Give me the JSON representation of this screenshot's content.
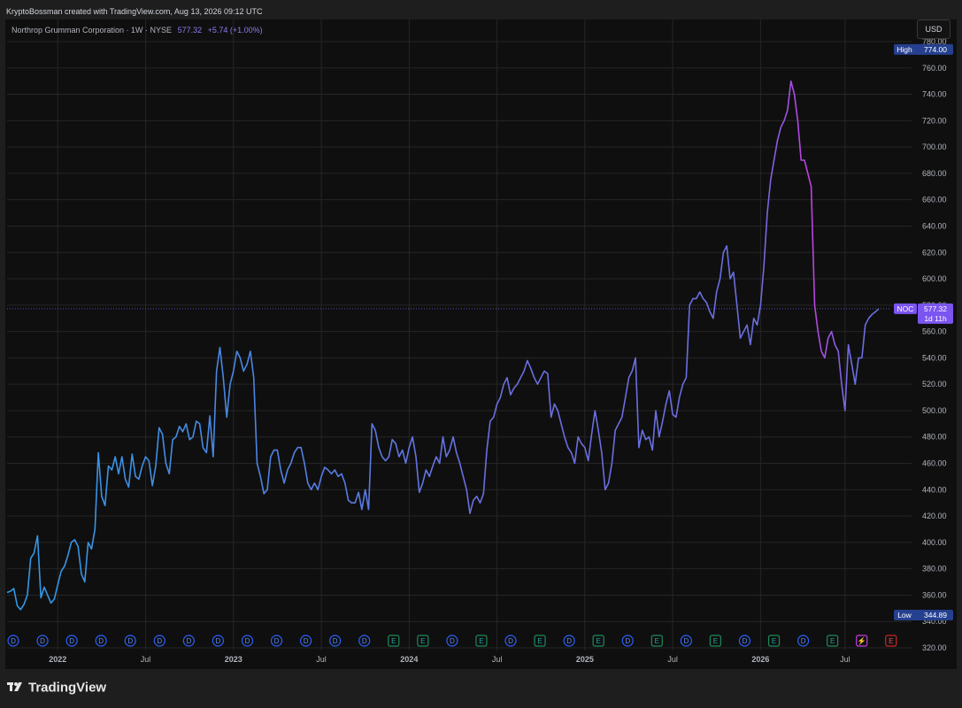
{
  "header": {
    "credit": "KryptoBossman created with TradingView.com, Aug 13, 2026 09:12 UTC"
  },
  "legend": {
    "symbol": "Northrop Grumman Corporation · 1W · NYSE",
    "price": "577.32",
    "change": "+5.74 (+1.00%)"
  },
  "currency_button": "USD",
  "footer": {
    "brand": "TradingView"
  },
  "colors": {
    "background": "#0f0f0f",
    "line_start": "#2e9be6",
    "line_mid": "#6a6ee0",
    "line_end": "#c23fe0",
    "label_blue": "#25408f",
    "label_purple": "#7b55f0"
  },
  "chart_data": {
    "type": "line",
    "title": "Northrop Grumman Corporation · 1W · NYSE",
    "series": [
      {
        "x_week_index": [
          0,
          1,
          2,
          3,
          4,
          5,
          6,
          7,
          8,
          9,
          10,
          11,
          12,
          13,
          14,
          15,
          16,
          17,
          18,
          19,
          20,
          21,
          22,
          23,
          24,
          25,
          26,
          27,
          28,
          29,
          30,
          31,
          32,
          33,
          34,
          35,
          36,
          37,
          38,
          39,
          40,
          41,
          42,
          43,
          44,
          45,
          46,
          47,
          48,
          49,
          50,
          51,
          52,
          53,
          54,
          55,
          56,
          57,
          58,
          59,
          60,
          61,
          62,
          63,
          64,
          65,
          66,
          67,
          68,
          69,
          70,
          71,
          72,
          73,
          74,
          75,
          76,
          77,
          78,
          79,
          80,
          81,
          82,
          83,
          84,
          85,
          86,
          87,
          88,
          89,
          90,
          91,
          92,
          93,
          94,
          95,
          96,
          97,
          98,
          99,
          100,
          101,
          102,
          103,
          104,
          105,
          106,
          107,
          108,
          109,
          110,
          111,
          112,
          113,
          114,
          115,
          116,
          117,
          118,
          119,
          120,
          121,
          122,
          123,
          124,
          125,
          126,
          127,
          128,
          129,
          130,
          131,
          132,
          133,
          134,
          135,
          136,
          137,
          138,
          139,
          140,
          141,
          142,
          143,
          144,
          145,
          146,
          147,
          148,
          149,
          150,
          151,
          152,
          153,
          154,
          155,
          156,
          157,
          158,
          159,
          160,
          161,
          162,
          163,
          164,
          165,
          166,
          167,
          168,
          169,
          170,
          171,
          172,
          173,
          174,
          175,
          176,
          177,
          178,
          179,
          180,
          181,
          182,
          183,
          184,
          185,
          186,
          187,
          188,
          189,
          190,
          191,
          192,
          193,
          194,
          195,
          196,
          197,
          198,
          199,
          200,
          201,
          202,
          203,
          204,
          205,
          206,
          207,
          208,
          209,
          210,
          211,
          212,
          213,
          214,
          215,
          216,
          217,
          218,
          219,
          220,
          221,
          222,
          223,
          224,
          225,
          226,
          227,
          228,
          229,
          230,
          231,
          232,
          233,
          234,
          235,
          236,
          237,
          238,
          239,
          240,
          241,
          242,
          243,
          244,
          245,
          246,
          247,
          248,
          249,
          250,
          251,
          252,
          253,
          254,
          255,
          256,
          257,
          258,
          259,
          260,
          261,
          262,
          263,
          264,
          265,
          266,
          267,
          268,
          269,
          270,
          271,
          272
        ],
        "values": [
          362,
          363,
          365,
          352,
          349,
          353,
          360,
          388,
          392,
          405,
          358,
          366,
          360,
          354,
          357,
          368,
          378,
          382,
          390,
          400,
          402,
          397,
          376,
          370,
          400,
          395,
          410,
          468,
          435,
          428,
          458,
          455,
          465,
          452,
          465,
          448,
          442,
          467,
          450,
          448,
          458,
          465,
          462,
          443,
          458,
          487,
          482,
          460,
          452,
          478,
          480,
          488,
          484,
          490,
          478,
          480,
          492,
          490,
          472,
          468,
          496,
          465,
          530,
          548,
          525,
          495,
          520,
          530,
          545,
          540,
          530,
          535,
          545,
          525,
          460,
          450,
          437,
          440,
          465,
          470,
          470,
          455,
          445,
          455,
          460,
          468,
          472,
          472,
          460,
          445,
          440,
          445,
          440,
          450,
          457,
          455,
          452,
          455,
          450,
          452,
          445,
          432,
          430,
          430,
          438,
          425,
          440,
          425,
          490,
          485,
          472,
          465,
          462,
          465,
          478,
          475,
          465,
          470,
          460,
          472,
          480,
          465,
          438,
          445,
          455,
          450,
          458,
          465,
          460,
          480,
          465,
          470,
          480,
          468,
          460,
          450,
          440,
          422,
          432,
          435,
          430,
          437,
          470,
          492,
          495,
          505,
          510,
          520,
          525,
          512,
          517,
          520,
          525,
          530,
          538,
          532,
          525,
          520,
          525,
          530,
          528,
          495,
          505,
          500,
          490,
          480,
          472,
          468,
          460,
          480,
          475,
          472,
          462,
          482,
          500,
          485,
          468,
          440,
          445,
          460,
          485,
          490,
          495,
          510,
          525,
          530,
          540,
          472,
          485,
          478,
          480,
          470,
          500,
          480,
          492,
          505,
          515,
          497,
          495,
          510,
          520,
          525,
          580,
          585,
          585,
          590,
          585,
          582,
          575,
          570,
          590,
          600,
          620,
          625,
          600,
          605,
          580,
          555,
          560,
          565,
          550,
          570,
          565,
          580,
          610,
          650,
          675,
          690,
          705,
          715,
          720,
          728,
          750,
          740,
          720,
          690,
          690,
          680,
          670,
          580,
          560,
          545,
          540,
          555,
          560,
          550,
          545,
          520,
          500,
          550,
          535,
          520,
          540,
          540,
          565,
          570,
          573,
          575,
          577.32
        ],
        "color_gradient": [
          "#2e9be6",
          "#6a6ee0",
          "#c23fe0"
        ]
      }
    ],
    "x_tick_labels": [
      "2022",
      "Jul",
      "2023",
      "Jul",
      "2024",
      "Jul",
      "2025",
      "Jul",
      "2026",
      "Jul"
    ],
    "y_tick_labels": [
      "320.00",
      "340.00",
      "360.00",
      "380.00",
      "400.00",
      "420.00",
      "440.00",
      "460.00",
      "480.00",
      "500.00",
      "520.00",
      "540.00",
      "560.00",
      "580.00",
      "600.00",
      "620.00",
      "640.00",
      "660.00",
      "680.00",
      "700.00",
      "720.00",
      "740.00",
      "760.00",
      "780.00"
    ],
    "ylim": [
      318,
      782
    ],
    "grid": true,
    "price_labels": {
      "high_label": "High",
      "high_value": "774.00",
      "low_label": "Low",
      "low_value": "344.89",
      "last_symbol": "NOC",
      "last_value": "577.32",
      "countdown": "1d 11h"
    },
    "events": {
      "markers": [
        "D",
        "D",
        "D",
        "D",
        "D",
        "D",
        "D",
        "D",
        "D",
        "D",
        "D",
        "D",
        "D",
        "E",
        "E",
        "D",
        "E",
        "D",
        "E",
        "D",
        "E",
        "D",
        "E",
        "D",
        "E",
        "D",
        "E",
        "D",
        "E",
        "⚡",
        "E"
      ]
    }
  }
}
